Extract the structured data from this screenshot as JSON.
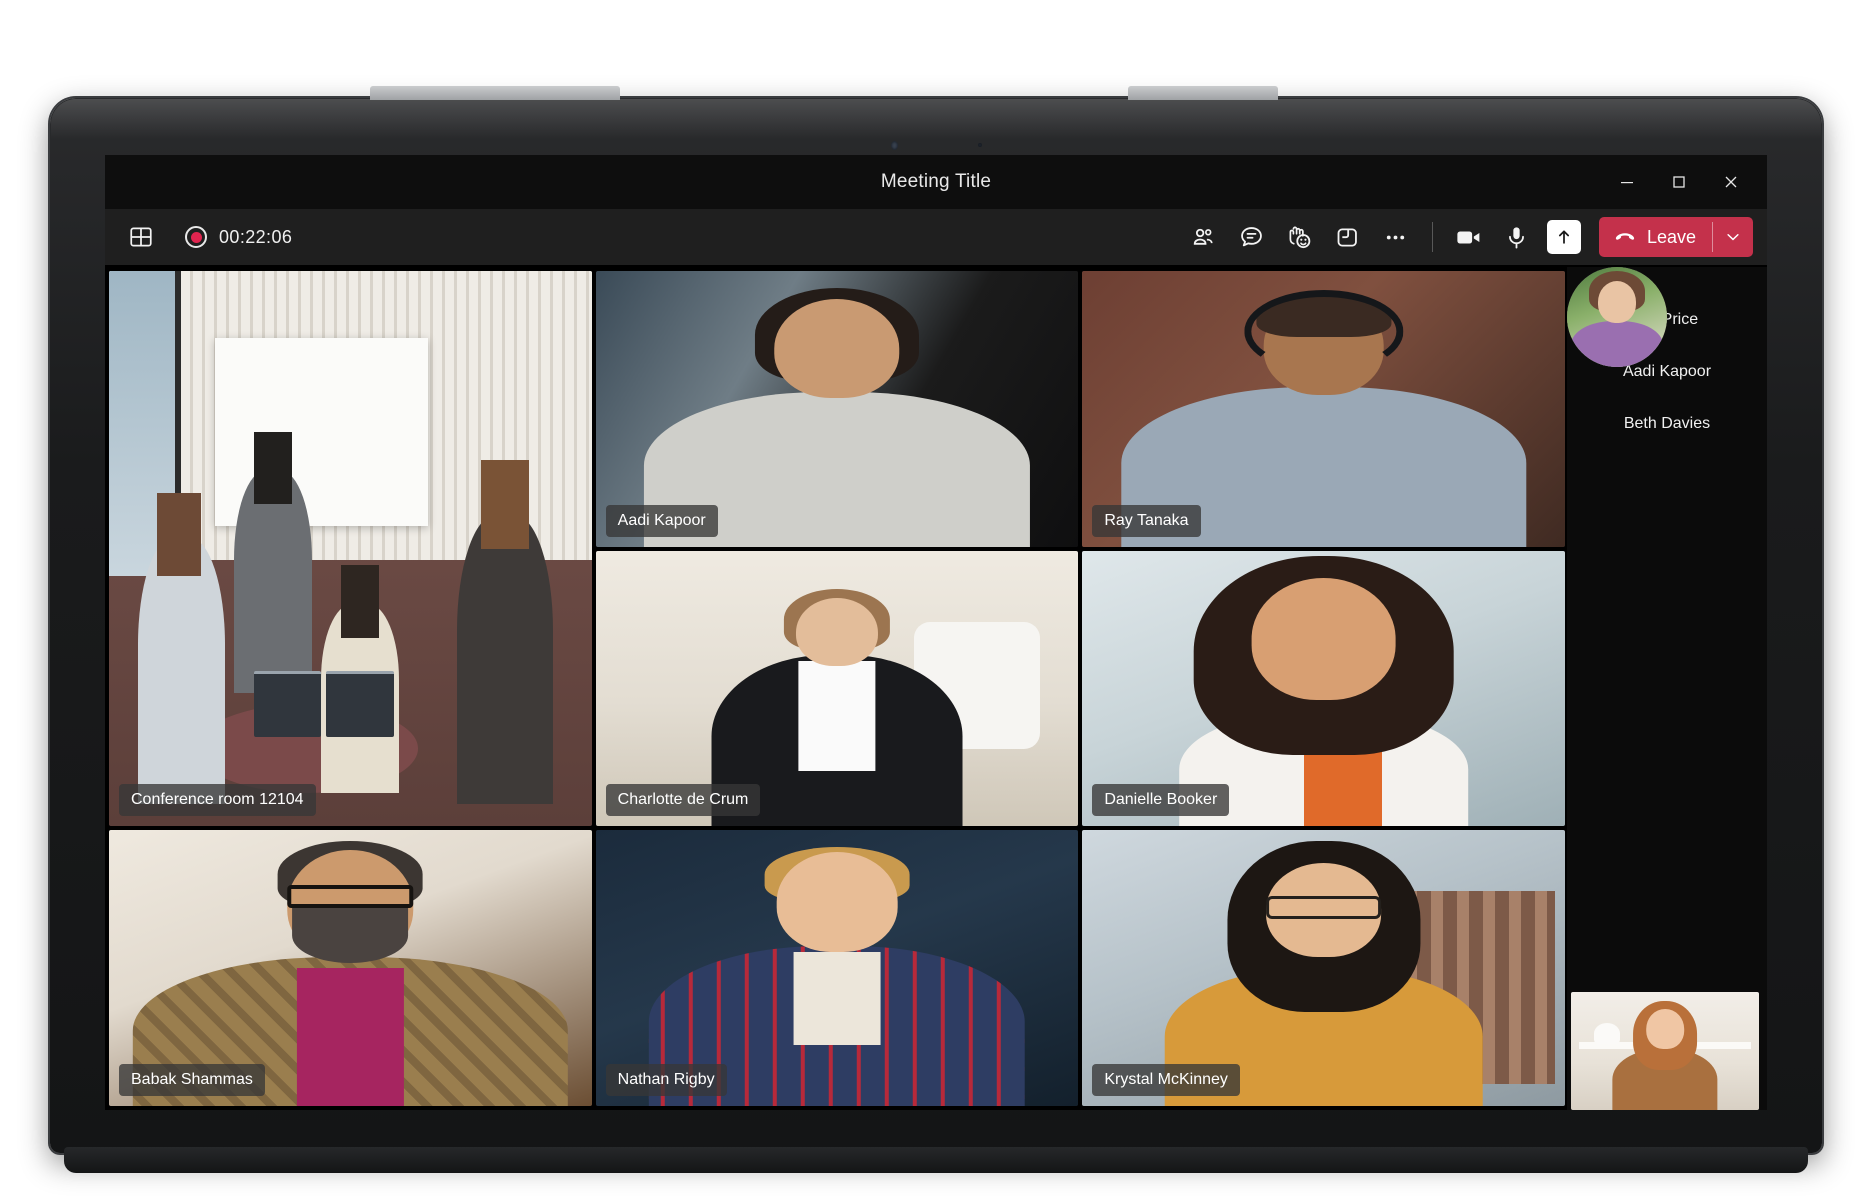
{
  "window": {
    "title": "Meeting Title",
    "controls": [
      {
        "name": "minimize",
        "label": "Minimize"
      },
      {
        "name": "maximize",
        "label": "Restore"
      },
      {
        "name": "close",
        "label": "Close"
      }
    ]
  },
  "toolbar": {
    "layout_label": "Gallery layout",
    "recording": {
      "label": "Recording",
      "timer": "00:22:06",
      "dot_color": "#e0244f"
    },
    "actions": [
      {
        "name": "people",
        "label": "People"
      },
      {
        "name": "chat",
        "label": "Chat"
      },
      {
        "name": "reactions",
        "label": "Reactions"
      },
      {
        "name": "breakout-rooms",
        "label": "Breakout rooms"
      },
      {
        "name": "more",
        "label": "More actions"
      }
    ],
    "camera_label": "Camera",
    "mic_label": "Mic",
    "share_label": "Share content",
    "leave": {
      "label": "Leave",
      "color": "#c4314b",
      "dropdown_label": "Leave options"
    }
  },
  "stage": {
    "tiles": [
      {
        "id": "conference",
        "name": "Conference room 12104"
      },
      {
        "id": "babak",
        "name": "Babak Shammas"
      },
      {
        "id": "aadi",
        "name": "Aadi Kapoor"
      },
      {
        "id": "charlotte",
        "name": "Charlotte de Crum"
      },
      {
        "id": "nathan",
        "name": "Nathan Rigby"
      },
      {
        "id": "ray",
        "name": "Ray Tanaka"
      },
      {
        "id": "danielle",
        "name": "Danielle Booker"
      },
      {
        "id": "krystal",
        "name": "Krystal McKinney"
      }
    ]
  },
  "roster": {
    "participants": [
      {
        "name": "MJ Price"
      },
      {
        "name": "Aadi Kapoor"
      },
      {
        "name": "Beth Davies"
      }
    ],
    "self_view_label": "Your video"
  }
}
